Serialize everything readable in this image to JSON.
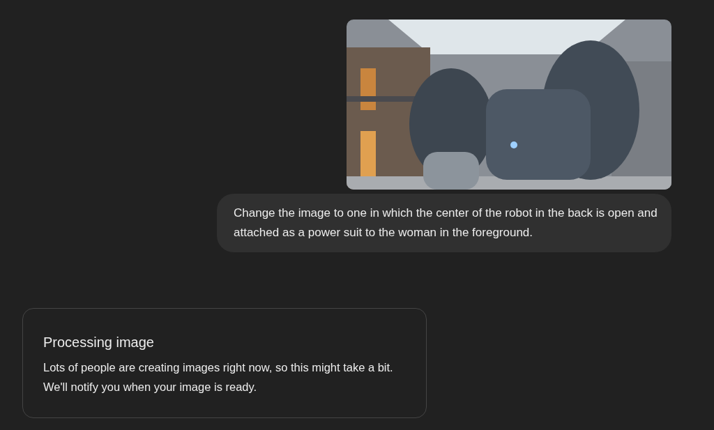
{
  "user_message": {
    "text": "Change the image to one in which the center of the robot in the back is open and attached as a power suit to the woman in the foreground."
  },
  "status_card": {
    "title": "Processing image",
    "body": "Lots of people are creating images right now, so this might take a bit. We'll notify you when your image is ready."
  }
}
